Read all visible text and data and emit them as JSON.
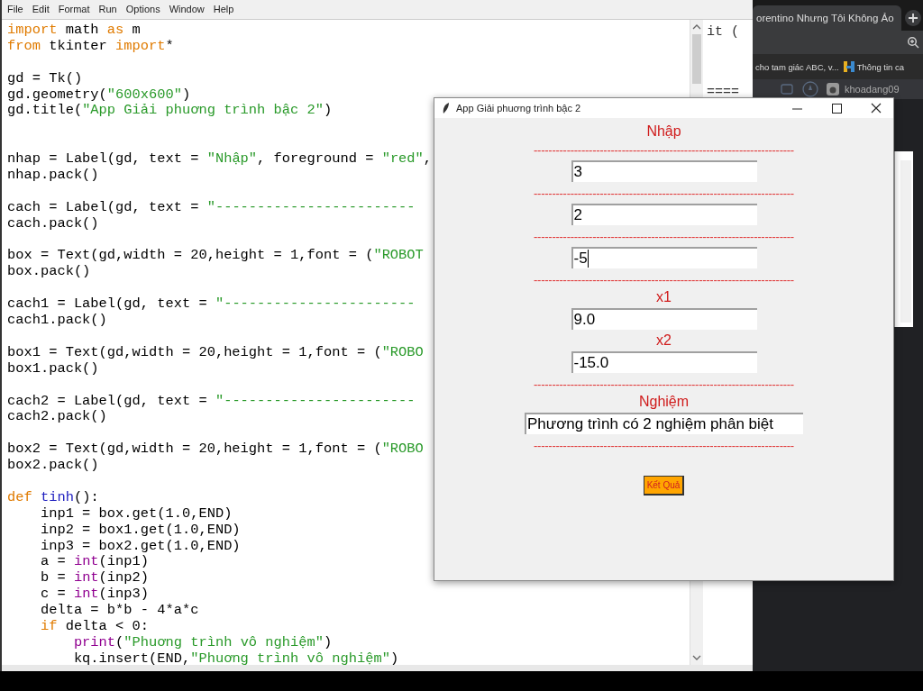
{
  "editor": {
    "menu": [
      "File",
      "Edit",
      "Format",
      "Run",
      "Options",
      "Window",
      "Help"
    ],
    "blocks": [
      {
        "spaced": false,
        "lines": [
          [
            {
              "text": "import",
              "kind": "keyword"
            },
            {
              "text": " math ",
              "kind": "plain"
            },
            {
              "text": "as",
              "kind": "keyword"
            },
            {
              "text": " m",
              "kind": "plain"
            }
          ],
          [
            {
              "text": "from",
              "kind": "keyword"
            },
            {
              "text": " tkinter ",
              "kind": "plain"
            },
            {
              "text": "import",
              "kind": "keyword"
            },
            {
              "text": "*",
              "kind": "plain"
            }
          ]
        ]
      },
      {
        "spaced": false,
        "lines": [
          [
            {
              "text": "gd = Tk()",
              "kind": "plain"
            }
          ],
          [
            {
              "text": "gd.geometry(",
              "kind": "plain"
            },
            {
              "text": "\"600x600\"",
              "kind": "string"
            },
            {
              "text": ")",
              "kind": "plain"
            }
          ],
          [
            {
              "text": "gd.title(",
              "kind": "plain"
            },
            {
              "text": "\"App Giải phuơng trình bậc 2\"",
              "kind": "string"
            },
            {
              "text": ")",
              "kind": "plain"
            }
          ]
        ]
      },
      {
        "spaced": true,
        "lines": [
          [
            {
              "text": "nhap = Label(gd, text = ",
              "kind": "plain"
            },
            {
              "text": "\"Nhập\"",
              "kind": "string"
            },
            {
              "text": ", foreground = ",
              "kind": "plain"
            },
            {
              "text": "\"red\"",
              "kind": "string"
            },
            {
              "text": ",",
              "kind": "plain"
            }
          ],
          [
            {
              "text": "nhap.pack()",
              "kind": "plain"
            }
          ]
        ]
      },
      {
        "spaced": false,
        "lines": [
          [
            {
              "text": "cach = Label(gd, text = ",
              "kind": "plain"
            },
            {
              "text": "\"------------------------",
              "kind": "string"
            }
          ],
          [
            {
              "text": "cach.pack()",
              "kind": "plain"
            }
          ]
        ]
      },
      {
        "spaced": false,
        "lines": [
          [
            {
              "text": "box = Text(gd,width = 20,height = 1,font = (",
              "kind": "plain"
            },
            {
              "text": "\"ROBOT",
              "kind": "string"
            }
          ],
          [
            {
              "text": "box.pack()",
              "kind": "plain"
            }
          ]
        ]
      },
      {
        "spaced": false,
        "lines": [
          [
            {
              "text": "cach1 = Label(gd, text = ",
              "kind": "plain"
            },
            {
              "text": "\"-----------------------",
              "kind": "string"
            }
          ],
          [
            {
              "text": "cach1.pack()",
              "kind": "plain"
            }
          ]
        ]
      },
      {
        "spaced": false,
        "lines": [
          [
            {
              "text": "box1 = Text(gd,width = 20,height = 1,font = (",
              "kind": "plain"
            },
            {
              "text": "\"ROBO",
              "kind": "string"
            }
          ],
          [
            {
              "text": "box1.pack()",
              "kind": "plain"
            }
          ]
        ]
      },
      {
        "spaced": false,
        "lines": [
          [
            {
              "text": "cach2 = Label(gd, text = ",
              "kind": "plain"
            },
            {
              "text": "\"-----------------------",
              "kind": "string"
            }
          ],
          [
            {
              "text": "cach2.pack()",
              "kind": "plain"
            }
          ]
        ]
      },
      {
        "spaced": false,
        "lines": [
          [
            {
              "text": "box2 = Text(gd,width = 20,height = 1,font = (",
              "kind": "plain"
            },
            {
              "text": "\"ROBO",
              "kind": "string"
            }
          ],
          [
            {
              "text": "box2.pack()",
              "kind": "plain"
            }
          ]
        ]
      },
      {
        "spaced": false,
        "lines": [
          [
            {
              "text": "def",
              "kind": "keyword"
            },
            {
              "text": " tinh",
              "kind": "defname"
            },
            {
              "text": "():",
              "kind": "plain"
            }
          ],
          [
            {
              "text": "    inp1 = box.get(1.0,END)",
              "kind": "plain"
            }
          ],
          [
            {
              "text": "    inp2 = box1.get(1.0,END)",
              "kind": "plain"
            }
          ],
          [
            {
              "text": "    inp3 = box2.get(1.0,END)",
              "kind": "plain"
            }
          ],
          [
            {
              "text": "    a = ",
              "kind": "plain"
            },
            {
              "text": "int",
              "kind": "builtin"
            },
            {
              "text": "(inp1)",
              "kind": "plain"
            }
          ],
          [
            {
              "text": "    b = ",
              "kind": "plain"
            },
            {
              "text": "int",
              "kind": "builtin"
            },
            {
              "text": "(inp2)",
              "kind": "plain"
            }
          ],
          [
            {
              "text": "    c = ",
              "kind": "plain"
            },
            {
              "text": "int",
              "kind": "builtin"
            },
            {
              "text": "(inp3)",
              "kind": "plain"
            }
          ],
          [
            {
              "text": "    delta = b*b - 4*a*c",
              "kind": "plain"
            }
          ],
          [
            {
              "text": "    if",
              "kind": "keyword"
            },
            {
              "text": " delta < 0:",
              "kind": "plain"
            }
          ],
          [
            {
              "text": "        print",
              "kind": "builtin"
            },
            {
              "text": "(",
              "kind": "plain"
            },
            {
              "text": "\"Phuơng trình vô nghiệm\"",
              "kind": "string"
            },
            {
              "text": ")",
              "kind": "plain"
            }
          ],
          [
            {
              "text": "        kq.insert(END,",
              "kind": "plain"
            },
            {
              "text": "\"Phuơng trình vô nghiệm\"",
              "kind": "string"
            },
            {
              "text": ")",
              "kind": "plain"
            }
          ]
        ]
      }
    ],
    "side_pane": {
      "lines": [
        "it (",
        "===="
      ]
    }
  },
  "browser": {
    "tab_title": "orentino Nhưng Tôi Không Ảo",
    "bookmarks": [
      {
        "text": "cho tam giác ABC, v...",
        "kind": "plain"
      },
      {
        "text": "Thông tin ca",
        "kind": "site"
      }
    ],
    "account": "khoadang09"
  },
  "app_window": {
    "title": "App Giải phuơng trình bậc 2",
    "items": [
      {
        "kind": "label",
        "text": "Nhập"
      },
      {
        "kind": "separator",
        "text": "-----------------------------------------------------------------------"
      },
      {
        "kind": "field",
        "value": "3",
        "wide": false,
        "focused": false
      },
      {
        "kind": "separator",
        "text": "-----------------------------------------------------------------------"
      },
      {
        "kind": "field",
        "value": "2",
        "wide": false,
        "focused": false
      },
      {
        "kind": "separator",
        "text": "-----------------------------------------------------------------------"
      },
      {
        "kind": "field",
        "value": "-5",
        "wide": false,
        "focused": true
      },
      {
        "kind": "separator",
        "text": "-----------------------------------------------------------------------"
      },
      {
        "kind": "label",
        "text": "x1"
      },
      {
        "kind": "field",
        "value": "9.0",
        "wide": false,
        "focused": false
      },
      {
        "kind": "label",
        "text": "x2"
      },
      {
        "kind": "field",
        "value": "-15.0",
        "wide": false,
        "focused": false
      },
      {
        "kind": "separator",
        "text": "-----------------------------------------------------------------------"
      },
      {
        "kind": "label",
        "text": "Nghiệm"
      },
      {
        "kind": "field",
        "value": "Phương trình có 2 nghiệm phân biệt",
        "wide": true,
        "focused": false
      },
      {
        "kind": "separator",
        "text": "-----------------------------------------------------------------------"
      },
      {
        "kind": "button",
        "text": "Kết Quả"
      }
    ]
  }
}
